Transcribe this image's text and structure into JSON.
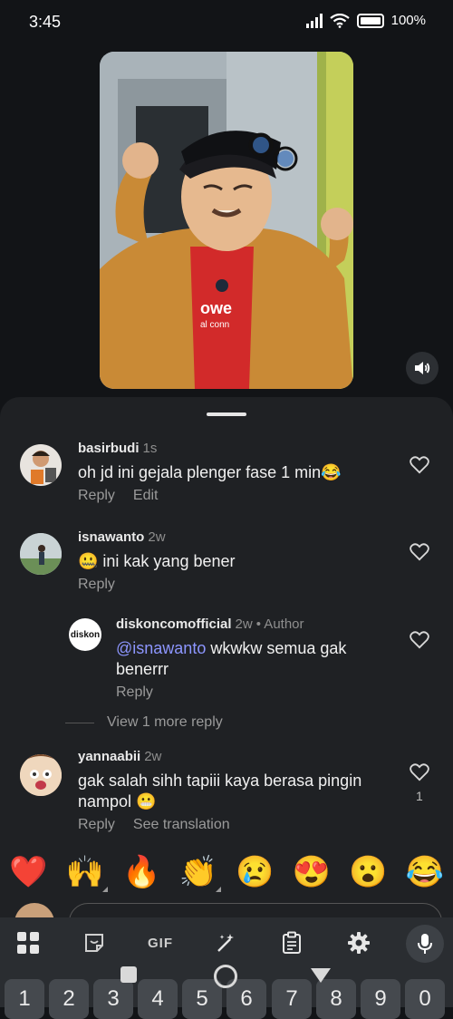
{
  "status": {
    "time": "3:45",
    "battery": "100%"
  },
  "video": {
    "shirt_text_1": "owe",
    "shirt_text_2": "al conn"
  },
  "comments": [
    {
      "username": "basirbudi",
      "age": "1s",
      "text": "oh jd ini gejala plenger fase 1  min😂",
      "actions": [
        "Reply",
        "Edit"
      ]
    },
    {
      "username": "isnawanto",
      "age": "2w",
      "text": "🤐 ini kak yang bener",
      "actions": [
        "Reply"
      ]
    },
    {
      "username": "diskoncomofficial",
      "age": "2w",
      "author_tag": "• Author",
      "mention": "@isnawanto",
      "text_line1": " wkwkw semua gak",
      "text_line2": "benerrr",
      "actions": [
        "Reply"
      ],
      "avatar_logo": "diskon"
    },
    {
      "username": "yannaabii",
      "age": "2w",
      "text_line1": "gak salah sihh tapiii kaya berasa pingin",
      "text_line2": "nampol 😬",
      "actions": [
        "Reply",
        "See translation"
      ],
      "likes": "1"
    }
  ],
  "view_more": "View 1 more reply",
  "reactions": [
    "❤️",
    "🙌",
    "🔥",
    "👏",
    "😢",
    "😍",
    "😮",
    "😂"
  ],
  "keyboard": {
    "gif_label": "GIF",
    "number_keys": [
      "1",
      "2",
      "3",
      "4",
      "5",
      "6",
      "7",
      "8",
      "9",
      "0"
    ]
  },
  "colors": {
    "background": "#121417",
    "sheet": "#1f2124",
    "mention": "#8d96ff",
    "keyboard": "#2a2d31"
  }
}
